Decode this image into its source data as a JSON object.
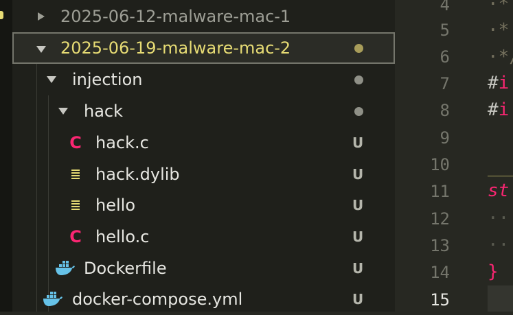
{
  "explorer": {
    "rows": [
      {
        "label": "2025-06-12-malware-mac-1",
        "kind": "folder-collapsed",
        "status": ""
      },
      {
        "label": "2025-06-19-malware-mac-2",
        "kind": "folder-expanded",
        "status": "dot"
      },
      {
        "label": "injection",
        "kind": "folder-expanded",
        "status": "dot"
      },
      {
        "label": "hack",
        "kind": "folder-expanded",
        "status": "dot"
      },
      {
        "label": "hack.c",
        "kind": "c-file",
        "status": "U"
      },
      {
        "label": "hack.dylib",
        "kind": "binary-file",
        "status": "U"
      },
      {
        "label": "hello",
        "kind": "binary-file",
        "status": "U"
      },
      {
        "label": "hello.c",
        "kind": "c-file",
        "status": "U"
      },
      {
        "label": "Dockerfile",
        "kind": "docker-file",
        "status": "U"
      },
      {
        "label": "docker-compose.yml",
        "kind": "docker-file",
        "status": "U"
      }
    ]
  },
  "editor": {
    "line_numbers": [
      "4",
      "5",
      "6",
      "7",
      "8",
      "9",
      "10",
      "11",
      "12",
      "13",
      "14",
      "15"
    ],
    "current_line": "15",
    "code_lines": {
      "l4": "·*",
      "l5": "·*",
      "l6": "·*/",
      "l7_hash": "#",
      "l7_kw": "i",
      "l8_hash": "#",
      "l8_kw": "i",
      "l11": "st",
      "l12": "··",
      "l13": "··",
      "l14": "}"
    }
  },
  "colors": {
    "accent_yellow": "#e6db74",
    "keyword_pink": "#f92672",
    "docker_blue": "#66c2e8"
  }
}
